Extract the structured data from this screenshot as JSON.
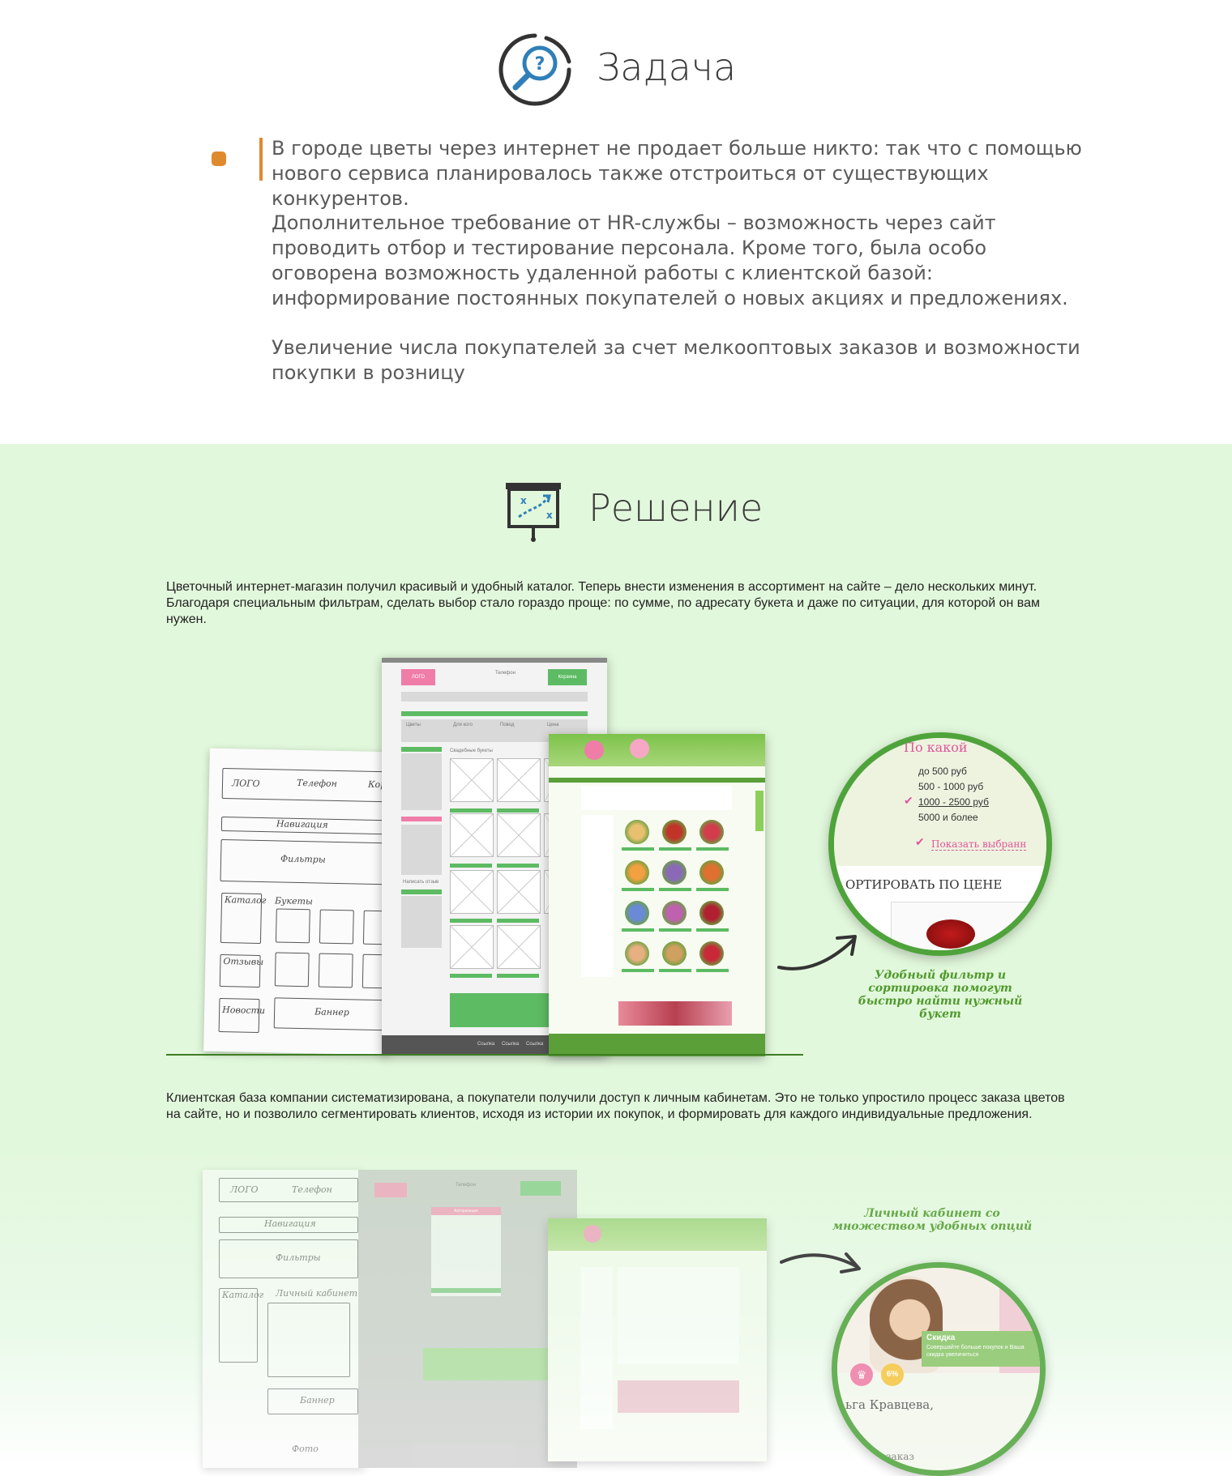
{
  "task": {
    "title": "Задача",
    "paragraphs": [
      "В городе цветы через интернет не продает больше никто: так что с помощью нового сервиса планировалось также отстроиться от существующих конкурентов.",
      "Дополнительное требование от HR-службы – возможность через сайт проводить отбор и тестирование персонала. Кроме того, была особо оговорена возможность удаленной работы с клиентской базой: информирование постоянных покупателей о новых акциях и предложениях.",
      "Увеличение числа покупателей за счет мелкооптовых заказов и возможности покупки в розницу"
    ]
  },
  "solution": {
    "title": "Решение",
    "paragraph1": "Цветочный интернет-магазин получил красивый и удобный каталог. Теперь внести изменения в ассортимент на сайте – дело нескольких минут. Благодаря специальным фильтрам, сделать выбор стало гораздо проще: по сумме, по адресату букета и даже по ситуации, для которой он вам нужен.",
    "paragraph2": "Клиентская база компании систематизирована, а покупатели получили доступ к личным кабинетам. Это не только упростило процесс заказа цветов на сайте, но и позволило сегментировать клиентов, исходя из истории их покупок, и формировать для каждого индивидуальные предложения.",
    "note1": "Удобный фильтр и сортировка помогут быстро найти нужный букет",
    "note2": "Личный кабинет со множеством удобных опций",
    "sketch1": {
      "labels": [
        "ЛОГО",
        "Телефон",
        "Корз",
        "Навигация",
        "Фильтры",
        "Каталог",
        "Букеты",
        "Отзывы",
        "Новости",
        "Баннер"
      ]
    },
    "wire1": {
      "logo": "ЛОГО",
      "phone": "Телефон",
      "cart": "Корзина",
      "filters": [
        "Цветы",
        "Для кого",
        "Повод",
        "Цена"
      ],
      "section": "Свадебные букеты",
      "reviews": "Написать отзыв",
      "footer": [
        "Ссылка",
        "Ссылка",
        "Ссылка"
      ]
    },
    "zoom1": {
      "heading": "По какой",
      "options": [
        "до 500 руб",
        "500 - 1000 руб",
        "1000 - 2500 руб",
        "5000 и более"
      ],
      "show_button": "Показать выбранн",
      "sort_label": "ОРТИРОВАТЬ ПО ЦЕНЕ"
    },
    "sketch2": {
      "labels": [
        "ЛОГО",
        "Телефон",
        "Навигация",
        "Фильтры",
        "Каталог",
        "Личный кабинет",
        "Баннер",
        "Фото"
      ]
    },
    "wire2": {
      "phone": "Телефон",
      "popup_title": "Авторизация"
    },
    "zoom2": {
      "discount_title": "Скидка",
      "discount_text": "Совершайте больше покупок и Ваша скидка увеличиться",
      "percent": "6%",
      "name": "ьга Кравцева,",
      "order": "заказ"
    },
    "colors": {
      "accent_green": "#4fa33b",
      "pink": "#f07ca8",
      "wire_green": "#5dbb63",
      "bullet_orange": "#e08a2e"
    }
  }
}
